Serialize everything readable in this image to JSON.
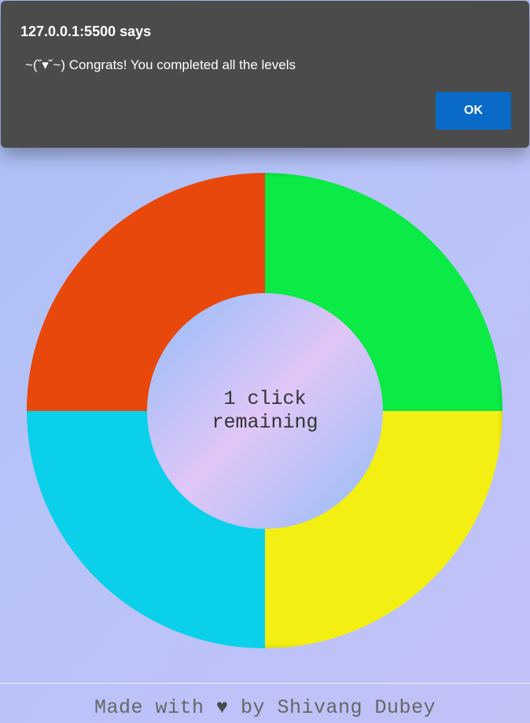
{
  "dialog": {
    "title": "127.0.0.1:5500 says",
    "message": "~(˘▾˘~) Congrats! You completed all the levels",
    "ok_label": "OK"
  },
  "game": {
    "status_text": "1 click remaining",
    "quadrants": [
      {
        "name": "red",
        "color": "#e8480b"
      },
      {
        "name": "green",
        "color": "#0bea45"
      },
      {
        "name": "blue",
        "color": "#0ad0ea"
      },
      {
        "name": "yellow",
        "color": "#f4ef13"
      }
    ],
    "center_gradient": [
      "#e0c6f7",
      "#92bdf7"
    ]
  },
  "footer": {
    "prefix": "Made with ",
    "heart": "♥",
    "suffix": " by Shivang Dubey"
  }
}
